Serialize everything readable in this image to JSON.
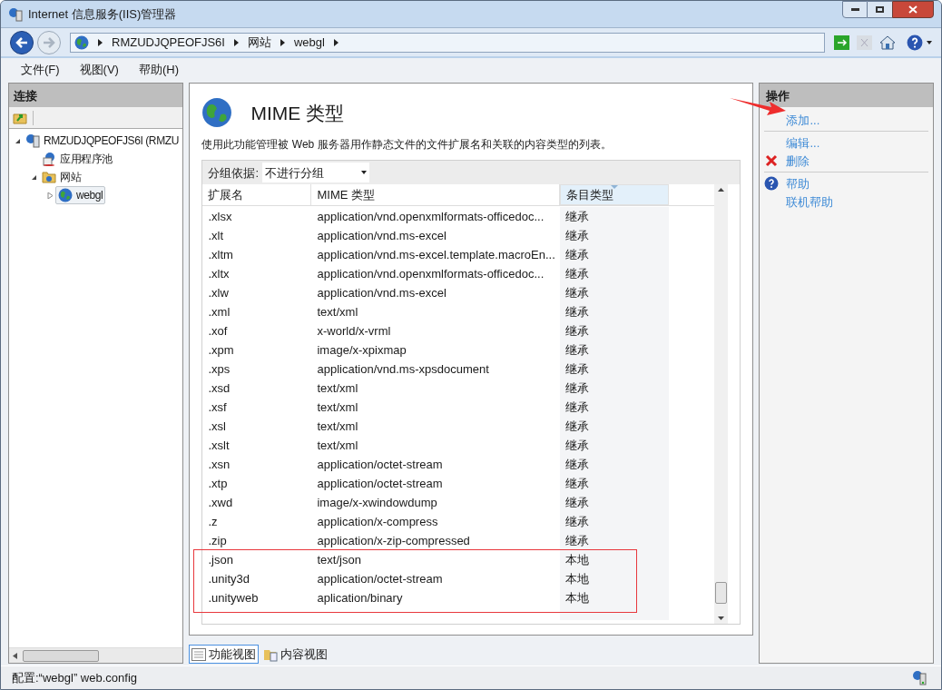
{
  "window": {
    "title": "Internet 信息服务(IIS)管理器"
  },
  "address": {
    "crumbs": [
      "RMZUDJQPEOFJS6I",
      "网站",
      "webgl"
    ]
  },
  "menu": [
    "文件(F)",
    "视图(V)",
    "帮助(H)"
  ],
  "connections": {
    "title": "连接",
    "tree": [
      {
        "label": "RMZUDJQPEOFJS6I (RMZU",
        "expanded": true,
        "kind": "server",
        "selected": false,
        "children": [
          {
            "label": "应用程序池",
            "kind": "pool",
            "selected": false
          },
          {
            "label": "网站",
            "kind": "folder",
            "expanded": true,
            "selected": false,
            "children": [
              {
                "label": "webgl",
                "kind": "site",
                "expanded": false,
                "selected": true
              }
            ]
          }
        ]
      }
    ]
  },
  "feature": {
    "title": "MIME 类型",
    "description": "使用此功能管理被 Web 服务器用作静态文件的文件扩展名和关联的内容类型的列表。",
    "group_label": "分组依据:",
    "group_value": "不进行分组",
    "columns": [
      {
        "label": "扩展名",
        "sorted": false
      },
      {
        "label": "MIME 类型",
        "sorted": false
      },
      {
        "label": "条目类型",
        "sorted": true
      }
    ],
    "rows": [
      {
        "ext": ".xlsx",
        "mime": "application/vnd.openxmlformats-officedoc...",
        "type": "继承"
      },
      {
        "ext": ".xlt",
        "mime": "application/vnd.ms-excel",
        "type": "继承"
      },
      {
        "ext": ".xltm",
        "mime": "application/vnd.ms-excel.template.macroEn...",
        "type": "继承"
      },
      {
        "ext": ".xltx",
        "mime": "application/vnd.openxmlformats-officedoc...",
        "type": "继承"
      },
      {
        "ext": ".xlw",
        "mime": "application/vnd.ms-excel",
        "type": "继承"
      },
      {
        "ext": ".xml",
        "mime": "text/xml",
        "type": "继承"
      },
      {
        "ext": ".xof",
        "mime": "x-world/x-vrml",
        "type": "继承"
      },
      {
        "ext": ".xpm",
        "mime": "image/x-xpixmap",
        "type": "继承"
      },
      {
        "ext": ".xps",
        "mime": "application/vnd.ms-xpsdocument",
        "type": "继承"
      },
      {
        "ext": ".xsd",
        "mime": "text/xml",
        "type": "继承"
      },
      {
        "ext": ".xsf",
        "mime": "text/xml",
        "type": "继承"
      },
      {
        "ext": ".xsl",
        "mime": "text/xml",
        "type": "继承"
      },
      {
        "ext": ".xslt",
        "mime": "text/xml",
        "type": "继承"
      },
      {
        "ext": ".xsn",
        "mime": "application/octet-stream",
        "type": "继承"
      },
      {
        "ext": ".xtp",
        "mime": "application/octet-stream",
        "type": "继承"
      },
      {
        "ext": ".xwd",
        "mime": "image/x-xwindowdump",
        "type": "继承"
      },
      {
        "ext": ".z",
        "mime": "application/x-compress",
        "type": "继承"
      },
      {
        "ext": ".zip",
        "mime": "application/x-zip-compressed",
        "type": "继承"
      }
    ],
    "marked_rows": [
      {
        "ext": ".json",
        "mime": "text/json",
        "type": "本地"
      },
      {
        "ext": ".unity3d",
        "mime": "application/octet-stream",
        "type": "本地"
      },
      {
        "ext": ".unityweb",
        "mime": "aplication/binary",
        "type": "本地"
      }
    ],
    "views": [
      {
        "label": "功能视图",
        "selected": true
      },
      {
        "label": "内容视图",
        "selected": false
      }
    ]
  },
  "actions": {
    "title": "操作",
    "groups": [
      [
        {
          "label": "添加...",
          "kind": "plain",
          "pointed": true
        }
      ],
      [
        {
          "label": "编辑...",
          "kind": "plain",
          "pointed": false
        },
        {
          "label": "删除",
          "kind": "delete",
          "pointed": false
        }
      ],
      [
        {
          "label": "帮助",
          "kind": "help",
          "pointed": false
        },
        {
          "label": "联机帮助",
          "kind": "plain",
          "pointed": false
        }
      ]
    ]
  },
  "status_bar": {
    "text": "配置:“webgl” web.config"
  }
}
